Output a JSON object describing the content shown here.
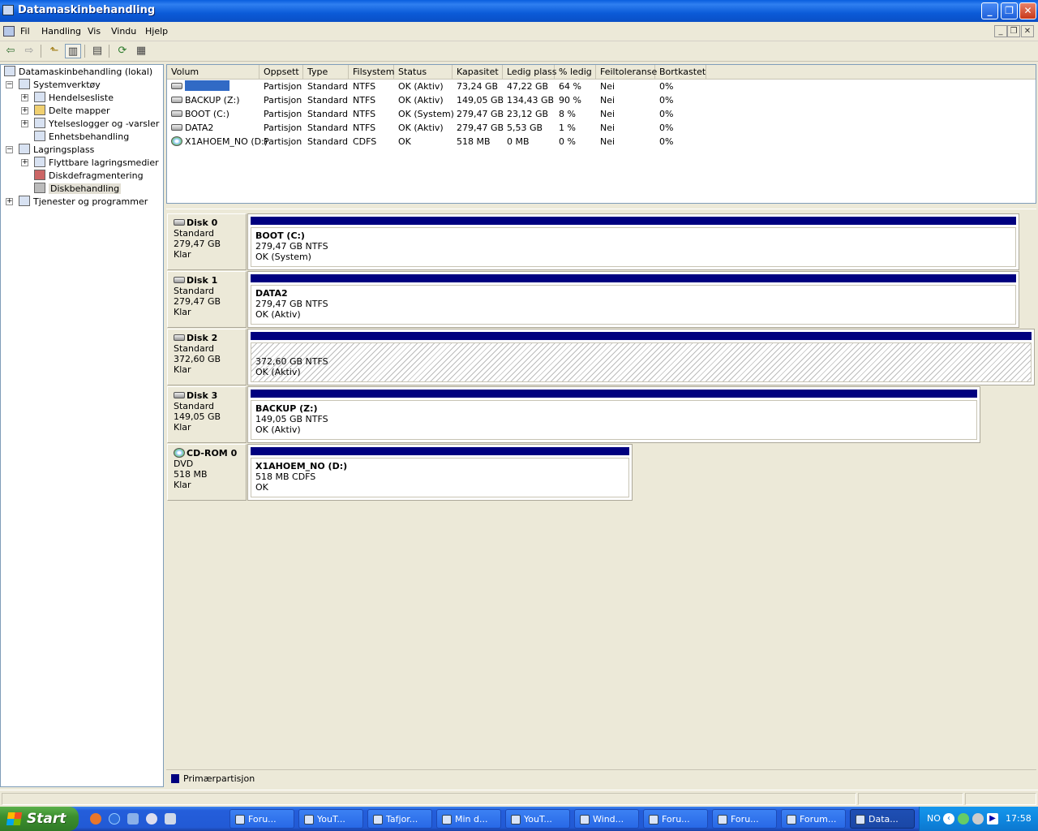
{
  "window": {
    "title": "Datamaskinbehandling",
    "min_glyph": "_",
    "max_glyph": "❐",
    "close_glyph": "✕"
  },
  "menu": [
    "Fil",
    "Handling",
    "Vis",
    "Vindu",
    "Hjelp"
  ],
  "mdi_buttons": [
    "_",
    "❐",
    "✕"
  ],
  "toolbar": [
    "back-icon",
    "forward-icon",
    "up-folder-icon",
    "show-hide-tree-icon",
    "properties-icon",
    "refresh-icon",
    "help-icon"
  ],
  "tree": {
    "root": "Datamaskinbehandling (lokal)",
    "system_tools": "Systemverktøy",
    "event_viewer": "Hendelsesliste",
    "shared_folders": "Delte mapper",
    "perf_logs": "Ytelseslogger og -varsler",
    "device_manager": "Enhetsbehandling",
    "storage": "Lagringsplass",
    "removable": "Flyttbare lagringsmedier",
    "defrag": "Diskdefragmentering",
    "disk_mgmt": "Diskbehandling",
    "services": "Tjenester og programmer",
    "expand_plus": "+",
    "expand_minus": "−"
  },
  "columns": [
    "Volum",
    "Oppsett",
    "Type",
    "Filsystem",
    "Status",
    "Kapasitet",
    "Ledig plass",
    "% ledig",
    "Feiltoleranse",
    "Bortkastet"
  ],
  "volumes": [
    {
      "name": "",
      "layout": "Partisjon",
      "type": "Standard",
      "fs": "NTFS",
      "status": "OK (Aktiv)",
      "capacity": "73,24 GB",
      "free": "47,22 GB",
      "pct": "64 %",
      "fault": "Nei",
      "waste": "0%"
    },
    {
      "name": "BACKUP (Z:)",
      "layout": "Partisjon",
      "type": "Standard",
      "fs": "NTFS",
      "status": "OK (Aktiv)",
      "capacity": "149,05 GB",
      "free": "134,43 GB",
      "pct": "90 %",
      "fault": "Nei",
      "waste": "0%"
    },
    {
      "name": "BOOT (C:)",
      "layout": "Partisjon",
      "type": "Standard",
      "fs": "NTFS",
      "status": "OK (System)",
      "capacity": "279,47 GB",
      "free": "23,12 GB",
      "pct": "8 %",
      "fault": "Nei",
      "waste": "0%"
    },
    {
      "name": "DATA2",
      "layout": "Partisjon",
      "type": "Standard",
      "fs": "NTFS",
      "status": "OK (Aktiv)",
      "capacity": "279,47 GB",
      "free": "5,53 GB",
      "pct": "1 %",
      "fault": "Nei",
      "waste": "0%"
    },
    {
      "name": "X1AHOEM_NO (D:)",
      "layout": "Partisjon",
      "type": "Standard",
      "fs": "CDFS",
      "status": "OK",
      "capacity": "518 MB",
      "free": "0 MB",
      "pct": "0 %",
      "fault": "Nei",
      "waste": "0%"
    }
  ],
  "disks": [
    {
      "name": "Disk 0",
      "kind": "Standard",
      "size": "279,47 GB",
      "state": "Klar",
      "vol_name": "BOOT  (C:)",
      "vol_size": "279,47 GB NTFS",
      "vol_status": "OK (System)"
    },
    {
      "name": "Disk 1",
      "kind": "Standard",
      "size": "279,47 GB",
      "state": "Klar",
      "vol_name": "DATA2",
      "vol_size": "279,47 GB NTFS",
      "vol_status": "OK (Aktiv)"
    },
    {
      "name": "Disk 2",
      "kind": "Standard",
      "size": "372,60 GB",
      "state": "Klar",
      "vol_name": "",
      "vol_size": "372,60 GB NTFS",
      "vol_status": "OK (Aktiv)"
    },
    {
      "name": "Disk 3",
      "kind": "Standard",
      "size": "149,05 GB",
      "state": "Klar",
      "vol_name": "BACKUP  (Z:)",
      "vol_size": "149,05 GB NTFS",
      "vol_status": "OK (Aktiv)"
    },
    {
      "name": "CD-ROM 0",
      "kind": "DVD",
      "size": "518 MB",
      "state": "Klar",
      "vol_name": "X1AHOEM_NO  (D:)",
      "vol_size": "518 MB CDFS",
      "vol_status": "OK"
    }
  ],
  "legend": "Primærpartisjon",
  "colors": {
    "primary_partition": "#00007f",
    "selection": "#316ac5"
  },
  "taskbar": {
    "start": "Start",
    "tasks": [
      "Foru...",
      "YouT...",
      "Tafjor...",
      "Min d...",
      "YouT...",
      "Wind...",
      "Foru...",
      "Foru...",
      "Forum...",
      "Data..."
    ],
    "lang": "NO",
    "clock": "17:58"
  }
}
